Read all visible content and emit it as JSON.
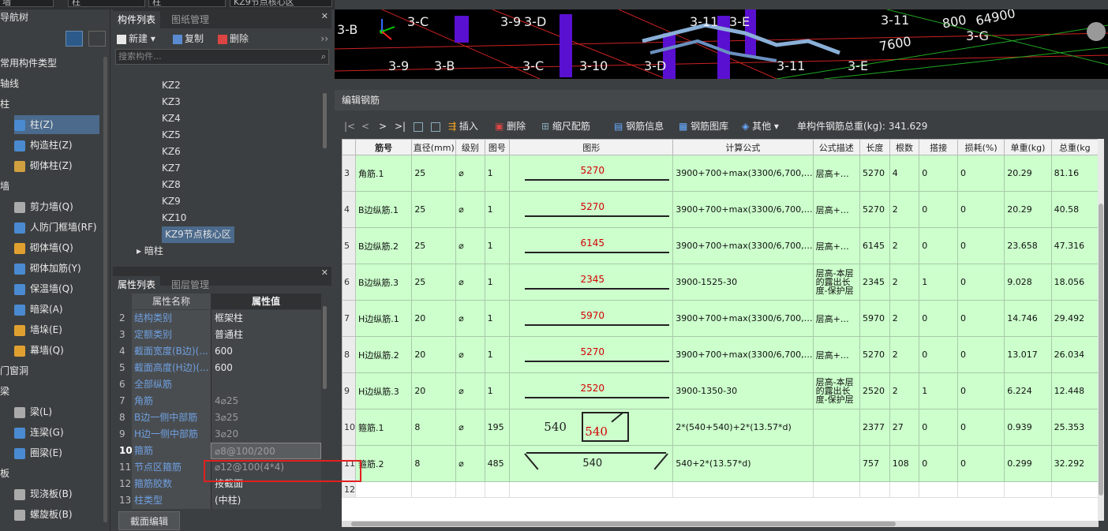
{
  "topstrip": {
    "fields": [
      "墙",
      "柱",
      "柱",
      "KZ9节点核心区"
    ]
  },
  "nav": {
    "title": "导航树",
    "items": [
      {
        "label": "常用构件类型",
        "level": 0
      },
      {
        "label": "轴线",
        "level": 0
      },
      {
        "label": "柱",
        "level": 0
      },
      {
        "label": "柱(Z)",
        "level": 1,
        "selected": true
      },
      {
        "label": "构造柱(Z)",
        "level": 1
      },
      {
        "label": "砌体柱(Z)",
        "level": 1
      },
      {
        "label": "墙",
        "level": 0
      },
      {
        "label": "剪力墙(Q)",
        "level": 1
      },
      {
        "label": "人防门框墙(RF)",
        "level": 1
      },
      {
        "label": "砌体墙(Q)",
        "level": 1
      },
      {
        "label": "砌体加筋(Y)",
        "level": 1
      },
      {
        "label": "保温墙(Q)",
        "level": 1
      },
      {
        "label": "暗梁(A)",
        "level": 1
      },
      {
        "label": "墙垛(E)",
        "level": 1
      },
      {
        "label": "幕墙(Q)",
        "level": 1
      },
      {
        "label": "门窗洞",
        "level": 0
      },
      {
        "label": "梁",
        "level": 0
      },
      {
        "label": "梁(L)",
        "level": 1
      },
      {
        "label": "连梁(G)",
        "level": 1
      },
      {
        "label": "圈梁(E)",
        "level": 1
      },
      {
        "label": "板",
        "level": 0
      },
      {
        "label": "现浇板(B)",
        "level": 1
      },
      {
        "label": "螺旋板(B)",
        "level": 1
      }
    ]
  },
  "complist": {
    "tab_active": "构件列表",
    "tab_inactive": "图纸管理",
    "new_label": "新建",
    "copy_label": "复制",
    "delete_label": "删除",
    "search_placeholder": "搜索构件...",
    "items": [
      "KZ2",
      "KZ3",
      "KZ4",
      "KZ5",
      "KZ6",
      "KZ7",
      "KZ8",
      "KZ9",
      "KZ10",
      "KZ9节点核心区"
    ],
    "group": "暗柱"
  },
  "props": {
    "tab_active": "属性列表",
    "tab_inactive": "图层管理",
    "col_name": "属性名称",
    "col_value": "属性值",
    "rows": [
      {
        "n": "2",
        "k": "结构类别",
        "v": "框架柱"
      },
      {
        "n": "3",
        "k": "定额类别",
        "v": "普通柱"
      },
      {
        "n": "4",
        "k": "截面宽度(B边)(...",
        "v": "600"
      },
      {
        "n": "5",
        "k": "截面高度(H边)(...",
        "v": "600"
      },
      {
        "n": "6",
        "k": "全部纵筋",
        "v": ""
      },
      {
        "n": "7",
        "k": "角筋",
        "v": "4⌀25",
        "gray": true
      },
      {
        "n": "8",
        "k": "B边一侧中部筋",
        "v": "3⌀25",
        "gray": true
      },
      {
        "n": "9",
        "k": "H边一侧中部筋",
        "v": "3⌀20",
        "gray": true
      },
      {
        "n": "10",
        "k": "箍筋",
        "v": "⌀8@100/200",
        "gray": true
      },
      {
        "n": "11",
        "k": "节点区箍筋",
        "v": "⌀12@100(4*4)",
        "gray": true
      },
      {
        "n": "12",
        "k": "箍筋胶数",
        "v": "按截面"
      },
      {
        "n": "13",
        "k": "柱类型",
        "v": "(中柱)"
      }
    ],
    "section_edit_label": "截面编辑"
  },
  "view3d": {
    "labels": [
      "3-B",
      "3-C",
      "3-9",
      "3-D",
      "3-11",
      "3-E",
      "3-11",
      "64900",
      "800",
      "7600",
      "3-G",
      "3-9",
      "3-B",
      "3-C",
      "3-10",
      "3-D",
      "3-11",
      "3-E"
    ]
  },
  "edit": {
    "title": "编辑钢筋",
    "toolbar": {
      "nav": [
        "|<",
        "<",
        ">",
        ">|"
      ],
      "insert": "插入",
      "delete": "删除",
      "scale": "缩尺配筋",
      "info": "钢筋信息",
      "lib": "钢筋图库",
      "other": "其他",
      "total_label": "单构件钢筋总重(kg):",
      "total_value": "341.629"
    },
    "columns": [
      "筋号",
      "直径(mm)",
      "级别",
      "图号",
      "图形",
      "计算公式",
      "公式描述",
      "长度",
      "根数",
      "搭接",
      "损耗(%)",
      "单重(kg)",
      "总重(kg"
    ],
    "rows": [
      {
        "i": "3",
        "name": "角筋.1",
        "d": "25",
        "grade": "⌀",
        "fig": "1",
        "shape": "5270",
        "formula": "3900+700+max(3300/6,700,…",
        "desc": "层高+…",
        "len": "5270",
        "cnt": "4",
        "lap": "0",
        "loss": "0",
        "unit": "20.29",
        "total": "81.16"
      },
      {
        "i": "4",
        "name": "B边纵筋.1",
        "d": "25",
        "grade": "⌀",
        "fig": "1",
        "shape": "5270",
        "formula": "3900+700+max(3300/6,700,…",
        "desc": "层高+…",
        "len": "5270",
        "cnt": "2",
        "lap": "0",
        "loss": "0",
        "unit": "20.29",
        "total": "40.58"
      },
      {
        "i": "5",
        "name": "B边纵筋.2",
        "d": "25",
        "grade": "⌀",
        "fig": "1",
        "shape": "6145",
        "formula": "3900+700+max(3300/6,700,…",
        "desc": "层高+…",
        "len": "6145",
        "cnt": "2",
        "lap": "0",
        "loss": "0",
        "unit": "23.658",
        "total": "47.316"
      },
      {
        "i": "6",
        "name": "B边纵筋.3",
        "d": "25",
        "grade": "⌀",
        "fig": "1",
        "shape": "2345",
        "formula": "3900-1525-30",
        "desc": "层高-本层的露出长度-保护层",
        "len": "2345",
        "cnt": "2",
        "lap": "1",
        "loss": "0",
        "unit": "9.028",
        "total": "18.056"
      },
      {
        "i": "7",
        "name": "H边纵筋.1",
        "d": "20",
        "grade": "⌀",
        "fig": "1",
        "shape": "5970",
        "formula": "3900+700+max(3300/6,700,…",
        "desc": "层高+…",
        "len": "5970",
        "cnt": "2",
        "lap": "0",
        "loss": "0",
        "unit": "14.746",
        "total": "29.492"
      },
      {
        "i": "8",
        "name": "H边纵筋.2",
        "d": "20",
        "grade": "⌀",
        "fig": "1",
        "shape": "5270",
        "formula": "3900+700+max(3300/6,700,…",
        "desc": "层高+…",
        "len": "5270",
        "cnt": "2",
        "lap": "0",
        "loss": "0",
        "unit": "13.017",
        "total": "26.034"
      },
      {
        "i": "9",
        "name": "H边纵筋.3",
        "d": "20",
        "grade": "⌀",
        "fig": "1",
        "shape": "2520",
        "formula": "3900-1350-30",
        "desc": "层高-本层的露出长度-保护层",
        "len": "2520",
        "cnt": "2",
        "lap": "1",
        "loss": "0",
        "unit": "6.224",
        "total": "12.448"
      },
      {
        "i": "10",
        "name": "箍筋.1",
        "d": "8",
        "grade": "⌀",
        "fig": "195",
        "shape": "stirrup",
        "s1": "540",
        "s2": "540",
        "formula": "2*(540+540)+2*(13.57*d)",
        "desc": "",
        "len": "2377",
        "cnt": "27",
        "lap": "0",
        "loss": "0",
        "unit": "0.939",
        "total": "25.353"
      },
      {
        "i": "11",
        "name": "箍筋.2",
        "d": "8",
        "grade": "⌀",
        "fig": "485",
        "shape": "tie",
        "s1": "540",
        "formula": "540+2*(13.57*d)",
        "desc": "",
        "len": "757",
        "cnt": "108",
        "lap": "0",
        "loss": "0",
        "unit": "0.299",
        "total": "32.292"
      }
    ],
    "empty_row": "12"
  }
}
